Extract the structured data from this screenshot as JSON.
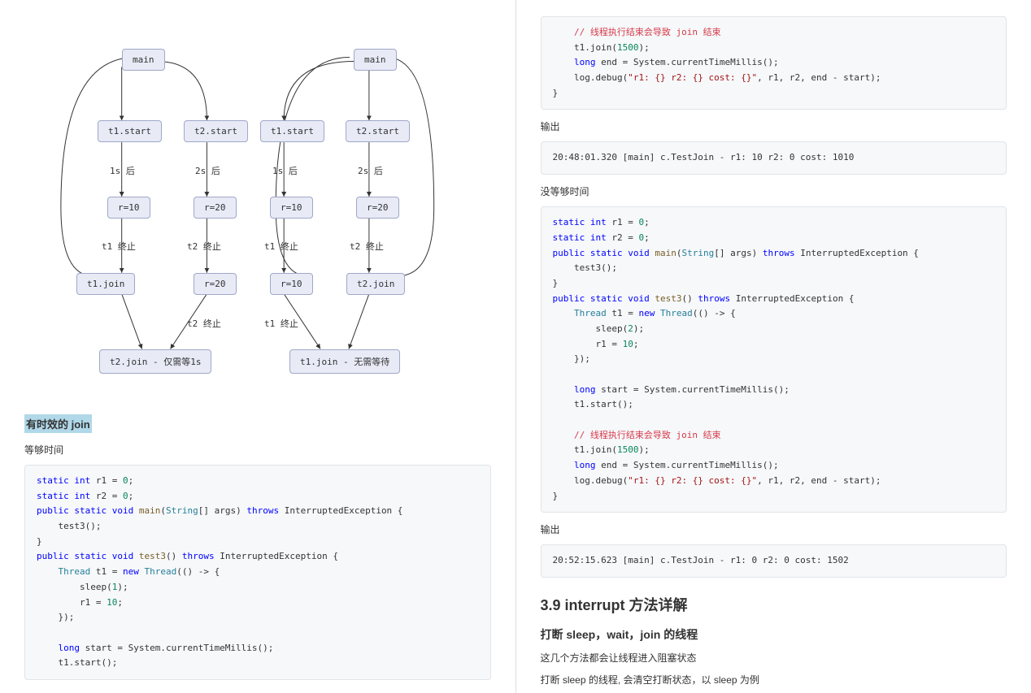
{
  "diagram": {
    "nodes": {
      "l_main": "main",
      "l_t1start": "t1.start",
      "l_r10": "r=10",
      "l_t1join": "t1.join",
      "l_t2start": "t2.start",
      "l_r20": "r=20",
      "l_final": "t2.join - 仅需等1s",
      "r_main": "main",
      "r_t2start": "t2.start",
      "r_r20": "r=20",
      "r_t2join": "t2.join",
      "r_t1start": "t1.start",
      "r_r10": "r=10",
      "r_final": "t1.join - 无需等待"
    },
    "labels": {
      "l_1s": "1s 后",
      "l_t1end": "t1 终止",
      "l_2s": "2s 后",
      "l_t2end": "t2 终止",
      "r_2s": "2s 后",
      "r_t2end": "t2 终止",
      "r_1s": "1s 后",
      "r_t1end": "t1 终止"
    }
  },
  "left": {
    "title": "有时效的 join",
    "sub1": "等够时间"
  },
  "right": {
    "out_label1": "输出",
    "out1": "20:48:01.320 [main] c.TestJoin - r1: 10 r2: 0 cost: 1010",
    "sub2": "没等够时间",
    "out_label2": "输出",
    "out2": "20:52:15.623 [main] c.TestJoin - r1: 0 r2: 0 cost: 1502",
    "h2": "3.9 interrupt 方法详解",
    "h3": "打断 sleep，wait，join 的线程",
    "p1": "这几个方法都会让线程进入阻塞状态",
    "p2": "打断 sleep 的线程, 会清空打断状态，以 sleep 为例"
  }
}
